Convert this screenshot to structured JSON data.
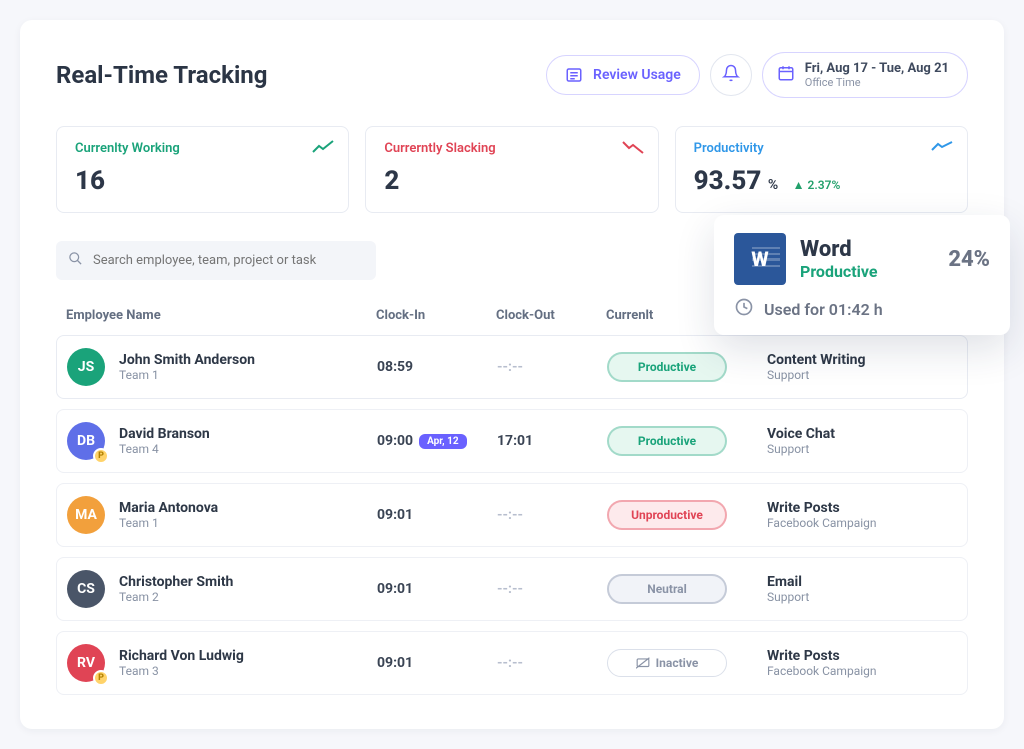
{
  "title": "Real-Time Tracking",
  "header": {
    "review_label": "Review Usage",
    "date_main": "Fri, Aug 17 - Tue, Aug 21",
    "date_sub": "Office Time"
  },
  "stats": {
    "working": {
      "label": "Currenlty Working",
      "value": "16"
    },
    "slacking": {
      "label": "Currerntly Slacking",
      "value": "2"
    },
    "productivity": {
      "label": "Productivity",
      "value": "93.57",
      "unit": "%",
      "delta": "2.37%"
    }
  },
  "search": {
    "placeholder": "Search employee, team, project or task"
  },
  "columns": {
    "emp": "Employee Name",
    "in": "Clock-In",
    "out": "Clock-Out",
    "status": "Currenlt"
  },
  "rows": [
    {
      "initials": "JS",
      "avatar": "#1aa37a",
      "badge": false,
      "name": "John Smith Anderson",
      "team": "Team 1",
      "in": "08:59",
      "in_date": "",
      "out": "--:--",
      "status": "Productive",
      "status_class": "productive",
      "project": "Content Writing",
      "project_sub": "Support"
    },
    {
      "initials": "DB",
      "avatar": "#5f6fe8",
      "badge": true,
      "name": "David Branson",
      "team": "Team 4",
      "in": "09:00",
      "in_date": "Apr, 12",
      "out": "17:01",
      "status": "Productive",
      "status_class": "productive",
      "project": "Voice Chat",
      "project_sub": "Support"
    },
    {
      "initials": "MA",
      "avatar": "#f2a03c",
      "badge": false,
      "name": "Maria Antonova",
      "team": "Team 1",
      "in": "09:01",
      "in_date": "",
      "out": "--:--",
      "status": "Unproductive",
      "status_class": "unproductive",
      "project": "Write Posts",
      "project_sub": "Facebook Campaign"
    },
    {
      "initials": "CS",
      "avatar": "#4a5568",
      "badge": false,
      "name": "Christopher Smith",
      "team": "Team 2",
      "in": "09:01",
      "in_date": "",
      "out": "--:--",
      "status": "Neutral",
      "status_class": "neutral",
      "project": "Email",
      "project_sub": "Support"
    },
    {
      "initials": "RV",
      "avatar": "#e04455",
      "badge": true,
      "name": "Richard Von Ludwig",
      "team": "Team 3",
      "in": "09:01",
      "in_date": "",
      "out": "--:--",
      "status": "Inactive",
      "status_class": "inactive",
      "project": "Write Posts",
      "project_sub": "Facebook Campaign"
    }
  ],
  "popover": {
    "app": "Word",
    "classification": "Productive",
    "percent": "24%",
    "used_for": "Used for 01:42 h"
  }
}
